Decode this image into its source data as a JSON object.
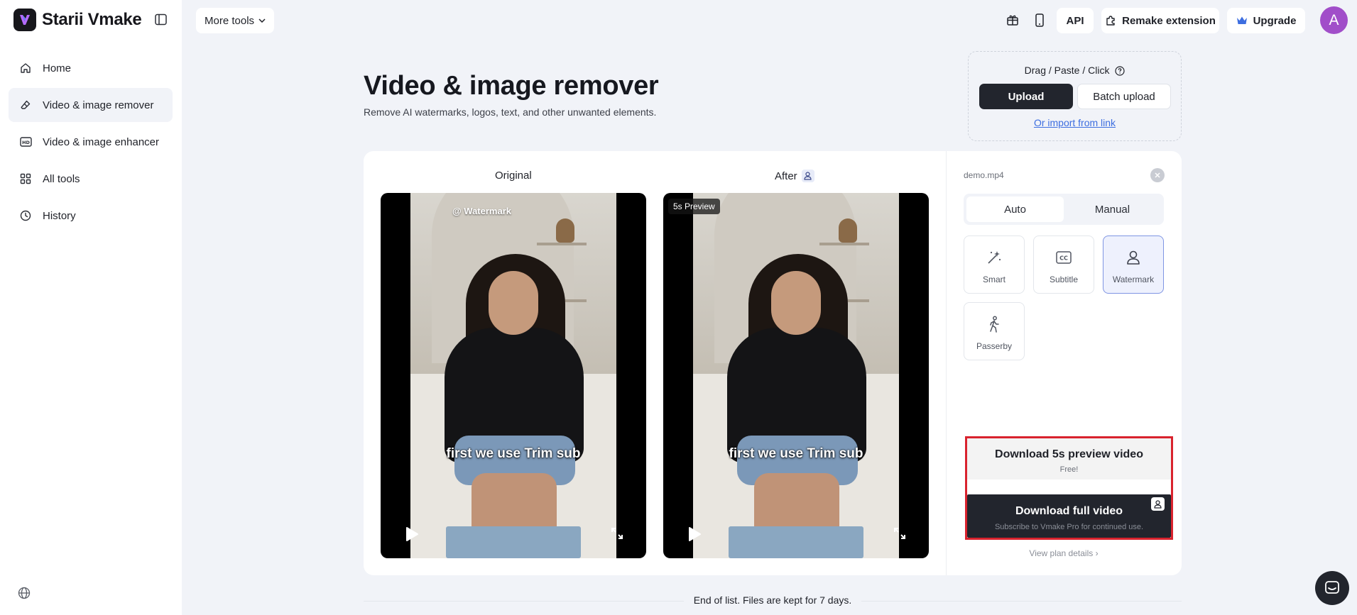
{
  "brand": {
    "name": "Starii Vmake"
  },
  "sidebar": {
    "items": [
      {
        "label": "Home",
        "icon": "home-icon"
      },
      {
        "label": "Video & image remover",
        "icon": "eraser-icon",
        "active": true
      },
      {
        "label": "Video & image enhancer",
        "icon": "hd-icon"
      },
      {
        "label": "All tools",
        "icon": "grid-icon"
      },
      {
        "label": "History",
        "icon": "clock-icon"
      }
    ]
  },
  "topbar": {
    "more_tools": "More tools",
    "api": "API",
    "remake_extension": "Remake extension",
    "upgrade": "Upgrade",
    "avatar_letter": "A"
  },
  "page": {
    "title": "Video & image remover",
    "subtitle": "Remove AI watermarks, logos, text, and other unwanted elements."
  },
  "upload": {
    "hint": "Drag / Paste / Click",
    "upload_label": "Upload",
    "batch_label": "Batch upload",
    "import_link": "Or import from link"
  },
  "compare": {
    "original_label": "Original",
    "after_label": "After",
    "watermark_text": "@ Watermark",
    "preview_badge": "5s Preview",
    "caption": "first we use Trim sub"
  },
  "panel": {
    "file_name": "demo.mp4",
    "modes": [
      "Auto",
      "Manual"
    ],
    "active_mode": "Auto",
    "tools": [
      {
        "label": "Smart",
        "icon": "magic-wand-icon"
      },
      {
        "label": "Subtitle",
        "icon": "cc-icon"
      },
      {
        "label": "Watermark",
        "icon": "watermark-icon",
        "selected": true
      },
      {
        "label": "Passerby",
        "icon": "walking-person-icon"
      }
    ],
    "download_preview": {
      "title": "Download 5s preview video",
      "sub": "Free!"
    },
    "download_full": {
      "title": "Download full video",
      "sub": "Subscribe to Vmake Pro for continued use."
    },
    "plan_link": "View plan details"
  },
  "footer": {
    "end_text": "End of list. Files are kept for 7 days."
  },
  "colors": {
    "accent": "#22252d",
    "highlight": "#d9232e",
    "avatar": "#a14ec9",
    "link": "#3d6ee0"
  }
}
